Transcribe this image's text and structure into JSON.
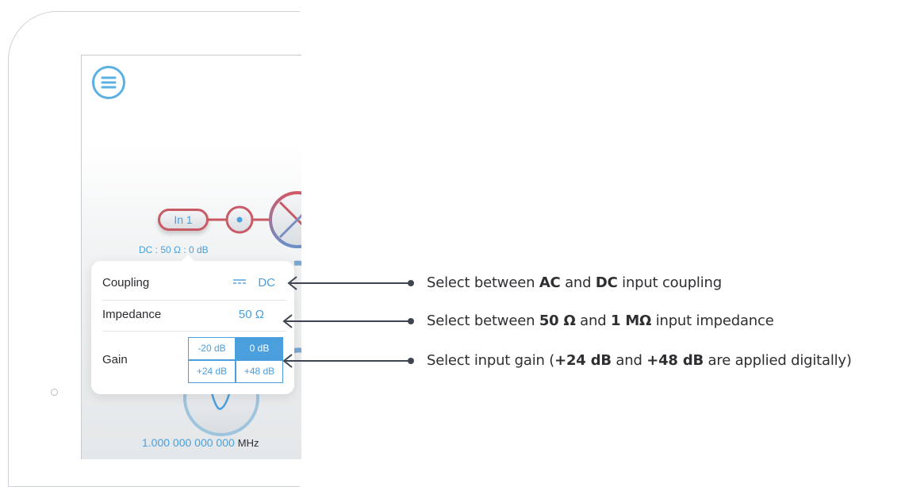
{
  "app": {
    "input_label": "In 1",
    "input_status": "DC : 50 Ω : 0 dB",
    "frequency_value": "1.000 000 000 000",
    "frequency_unit": "MHz"
  },
  "popover": {
    "coupling": {
      "label": "Coupling",
      "value": "DC",
      "icon": "dc-coupling-icon"
    },
    "impedance": {
      "label": "Impedance",
      "value": "50 Ω"
    },
    "gain": {
      "label": "Gain",
      "options": [
        "-20 dB",
        "0 dB",
        "+24 dB",
        "+48 dB"
      ],
      "selected": "0 dB"
    }
  },
  "callouts": [
    {
      "pre": "Select between ",
      "b1": "AC",
      "mid": " and ",
      "b2": "DC",
      "post": " input coupling"
    },
    {
      "pre": "Select between ",
      "b1": "50 Ω",
      "mid": " and ",
      "b2": "1 MΩ",
      "post": " input impedance"
    },
    {
      "pre": "Select input gain (",
      "b1": "+24 dB",
      "mid": " and ",
      "b2": "+48 dB",
      "post": " are applied digitally)"
    }
  ],
  "colors": {
    "accent": "#4a9fdc",
    "menu_ring": "#5cb1e4",
    "input_ring": "#c85a66",
    "callout_line": "#3f4550"
  }
}
